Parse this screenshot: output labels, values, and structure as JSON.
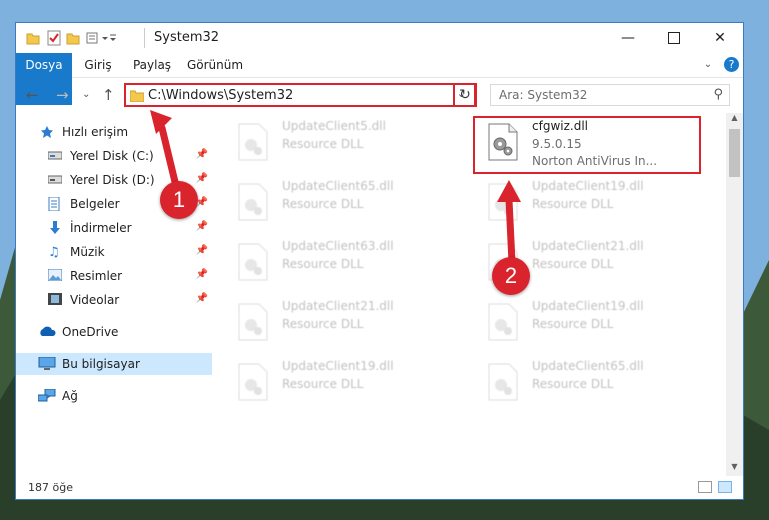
{
  "window": {
    "title": "System32",
    "controls": [
      "minimize-icon",
      "maximize-icon",
      "close-icon"
    ]
  },
  "ribbon": {
    "tabs": [
      "Dosya",
      "Giriş",
      "Paylaş",
      "Görünüm"
    ],
    "help": "?"
  },
  "navigation": {
    "address": "C:\\Windows\\System32",
    "search_placeholder": "Ara: System32"
  },
  "sidebar": {
    "items": [
      {
        "label": "Hızlı erişim",
        "icon": "star-icon"
      },
      {
        "label": "Yerel Disk (C:)",
        "icon": "drive-icon",
        "pinned": true
      },
      {
        "label": "Yerel Disk (D:)",
        "icon": "drive-icon",
        "pinned": true
      },
      {
        "label": "Belgeler",
        "icon": "document-icon",
        "pinned": true
      },
      {
        "label": "İndirmeler",
        "icon": "download-icon",
        "pinned": true
      },
      {
        "label": "Müzik",
        "icon": "music-icon",
        "pinned": true
      },
      {
        "label": "Resimler",
        "icon": "pictures-icon",
        "pinned": true
      },
      {
        "label": "Videolar",
        "icon": "video-icon",
        "pinned": true
      },
      {
        "label": "OneDrive",
        "icon": "cloud-icon"
      },
      {
        "label": "Bu bilgisayar",
        "icon": "computer-icon",
        "selected": true
      },
      {
        "label": "Ağ",
        "icon": "network-icon"
      }
    ]
  },
  "files": {
    "highlighted": {
      "name": "cfgwiz.dll",
      "version": "9.5.0.15",
      "description": "Norton AntiVirus In..."
    },
    "faded": [
      {
        "name": "UpdateClient5.dll",
        "desc": "Resource DLL"
      },
      {
        "name": "UpdateClient65.dll",
        "desc": "Resource DLL"
      },
      {
        "name": "UpdateClient19.dll",
        "desc": "Resource DLL"
      },
      {
        "name": "UpdateClient63.dll",
        "desc": "Resource DLL"
      },
      {
        "name": "UpdateClient21.dll",
        "desc": "Resource DLL"
      },
      {
        "name": "UpdateClient21.dll",
        "desc": "Resource DLL"
      },
      {
        "name": "UpdateClient19.dll",
        "desc": "Resource DLL"
      },
      {
        "name": "UpdateClient19.dll",
        "desc": "Resource DLL"
      },
      {
        "name": "UpdateClient65.dll",
        "desc": "Resource DLL"
      }
    ]
  },
  "status": {
    "item_count": "187 öğe"
  },
  "annotations": {
    "step1": "1",
    "step2": "2"
  },
  "colors": {
    "accent": "#1979ca",
    "annotation_red": "#d9232d",
    "selection": "#cce8ff"
  }
}
